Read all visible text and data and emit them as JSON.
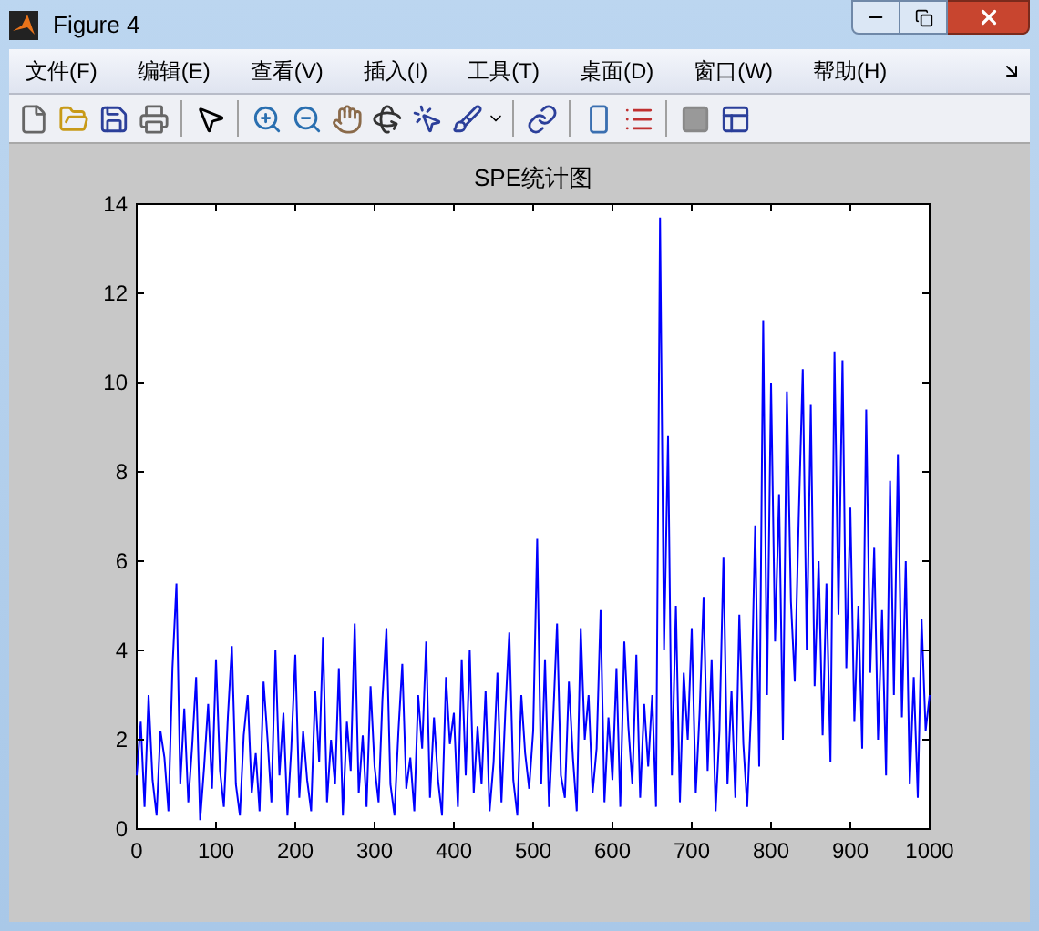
{
  "window": {
    "title": "Figure 4"
  },
  "menu": [
    "文件(F)",
    "编辑(E)",
    "查看(V)",
    "插入(I)",
    "工具(T)",
    "桌面(D)",
    "窗口(W)",
    "帮助(H)"
  ],
  "chart_data": {
    "type": "line",
    "title": "SPE统计图",
    "xlim": [
      0,
      1000
    ],
    "ylim": [
      0,
      14
    ],
    "xticks": [
      0,
      100,
      200,
      300,
      400,
      500,
      600,
      700,
      800,
      900,
      1000
    ],
    "yticks": [
      0,
      2,
      4,
      6,
      8,
      10,
      12,
      14
    ],
    "x": [
      0,
      5,
      10,
      15,
      20,
      25,
      30,
      35,
      40,
      45,
      50,
      55,
      60,
      65,
      70,
      75,
      80,
      85,
      90,
      95,
      100,
      105,
      110,
      115,
      120,
      125,
      130,
      135,
      140,
      145,
      150,
      155,
      160,
      165,
      170,
      175,
      180,
      185,
      190,
      195,
      200,
      205,
      210,
      215,
      220,
      225,
      230,
      235,
      240,
      245,
      250,
      255,
      260,
      265,
      270,
      275,
      280,
      285,
      290,
      295,
      300,
      305,
      310,
      315,
      320,
      325,
      330,
      335,
      340,
      345,
      350,
      355,
      360,
      365,
      370,
      375,
      380,
      385,
      390,
      395,
      400,
      405,
      410,
      415,
      420,
      425,
      430,
      435,
      440,
      445,
      450,
      455,
      460,
      465,
      470,
      475,
      480,
      485,
      490,
      495,
      500,
      505,
      510,
      515,
      520,
      525,
      530,
      535,
      540,
      545,
      550,
      555,
      560,
      565,
      570,
      575,
      580,
      585,
      590,
      595,
      600,
      605,
      610,
      615,
      620,
      625,
      630,
      635,
      640,
      645,
      650,
      655,
      660,
      665,
      670,
      675,
      680,
      685,
      690,
      695,
      700,
      705,
      710,
      715,
      720,
      725,
      730,
      735,
      740,
      745,
      750,
      755,
      760,
      765,
      770,
      775,
      780,
      785,
      790,
      795,
      800,
      805,
      810,
      815,
      820,
      825,
      830,
      835,
      840,
      845,
      850,
      855,
      860,
      865,
      870,
      875,
      880,
      885,
      890,
      895,
      900,
      905,
      910,
      915,
      920,
      925,
      930,
      935,
      940,
      945,
      950,
      955,
      960,
      965,
      970,
      975,
      980,
      985,
      990,
      995,
      1000
    ],
    "series": [
      {
        "color": "#0000ff",
        "values": [
          1.2,
          2.4,
          0.5,
          3.0,
          1.1,
          0.3,
          2.2,
          1.6,
          0.4,
          3.6,
          5.5,
          1.0,
          2.7,
          0.6,
          1.9,
          3.4,
          0.2,
          1.4,
          2.8,
          0.9,
          3.8,
          1.3,
          0.5,
          2.5,
          4.1,
          1.0,
          0.3,
          2.1,
          3.0,
          0.8,
          1.7,
          0.4,
          3.3,
          2.0,
          0.6,
          4.0,
          1.2,
          2.6,
          0.3,
          1.8,
          3.9,
          0.7,
          2.2,
          1.1,
          0.4,
          3.1,
          1.5,
          4.3,
          0.6,
          2.0,
          1.0,
          3.6,
          0.3,
          2.4,
          1.3,
          4.6,
          0.8,
          2.1,
          0.5,
          3.2,
          1.4,
          0.6,
          2.9,
          4.5,
          1.0,
          0.3,
          2.2,
          3.7,
          0.9,
          1.6,
          0.4,
          3.0,
          1.8,
          4.2,
          0.7,
          2.5,
          1.1,
          0.3,
          3.4,
          1.9,
          2.6,
          0.5,
          3.8,
          1.2,
          4.0,
          0.8,
          2.3,
          1.0,
          3.1,
          0.4,
          1.5,
          3.5,
          0.6,
          2.7,
          4.4,
          1.1,
          0.3,
          3.0,
          1.7,
          0.9,
          2.2,
          6.5,
          1.0,
          3.8,
          0.5,
          2.4,
          4.6,
          1.2,
          0.7,
          3.3,
          1.6,
          0.4,
          4.5,
          2.0,
          3.0,
          0.8,
          1.8,
          4.9,
          0.6,
          2.5,
          1.1,
          3.6,
          0.5,
          4.2,
          2.3,
          1.0,
          3.9,
          0.7,
          2.8,
          1.4,
          3.0,
          0.5,
          13.7,
          4.0,
          8.8,
          1.2,
          5.0,
          0.6,
          3.5,
          2.0,
          4.5,
          0.8,
          2.6,
          5.2,
          1.3,
          3.8,
          0.4,
          2.2,
          6.1,
          1.0,
          3.1,
          0.7,
          4.8,
          1.9,
          0.5,
          2.7,
          6.8,
          1.4,
          11.4,
          3.0,
          10.0,
          4.2,
          7.5,
          2.0,
          9.8,
          5.1,
          3.3,
          7.0,
          10.3,
          4.0,
          9.5,
          3.2,
          6.0,
          2.1,
          5.5,
          1.5,
          10.7,
          4.8,
          10.5,
          3.6,
          7.2,
          2.4,
          5.0,
          1.8,
          9.4,
          3.5,
          6.3,
          2.0,
          4.9,
          1.2,
          7.8,
          3.0,
          8.4,
          2.5,
          6.0,
          1.0,
          3.4,
          0.7,
          4.7,
          2.2,
          3.0
        ]
      }
    ]
  }
}
